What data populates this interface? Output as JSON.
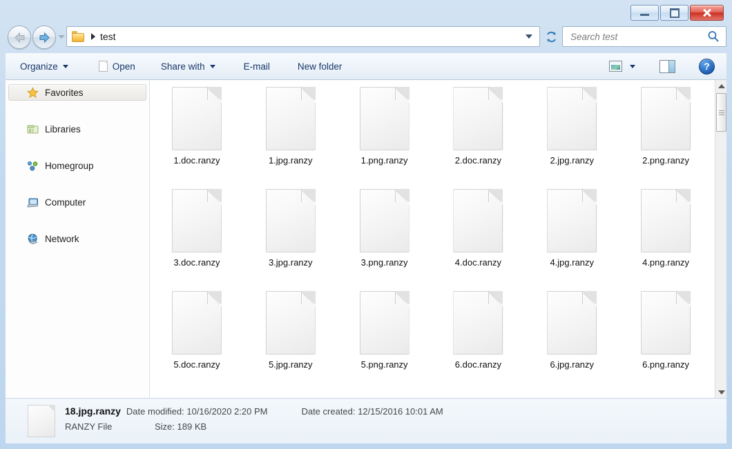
{
  "window": {
    "title": "",
    "controls": {
      "minimize": "Minimize",
      "maximize": "Maximize",
      "close": "Close"
    }
  },
  "navbar": {
    "back": "Back",
    "forward": "Forward",
    "recent_pages": "Recent pages",
    "breadcrumb": {
      "folder_icon": "folder-icon",
      "separator": "▸",
      "path": "test"
    },
    "refresh": "Refresh",
    "search": {
      "placeholder": "Search test",
      "value": "",
      "icon": "search-icon"
    }
  },
  "toolbar": {
    "organize": "Organize",
    "open": "Open",
    "share_with": "Share with",
    "email": "E-mail",
    "new_folder": "New folder",
    "change_view": "change-view-icon",
    "preview_pane": "preview-pane-icon",
    "help": "?"
  },
  "sidebar": {
    "items": [
      {
        "label": "Favorites",
        "icon": "star-icon",
        "selected": true
      },
      {
        "label": "Libraries",
        "icon": "libraries-icon",
        "selected": false
      },
      {
        "label": "Homegroup",
        "icon": "homegroup-icon",
        "selected": false
      },
      {
        "label": "Computer",
        "icon": "computer-icon",
        "selected": false
      },
      {
        "label": "Network",
        "icon": "network-icon",
        "selected": false
      }
    ]
  },
  "content": {
    "view": "large-icons",
    "files": [
      {
        "name": "1.doc.ranzy"
      },
      {
        "name": "1.jpg.ranzy"
      },
      {
        "name": "1.png.ranzy"
      },
      {
        "name": "2.doc.ranzy"
      },
      {
        "name": "2.jpg.ranzy"
      },
      {
        "name": "2.png.ranzy"
      },
      {
        "name": "3.doc.ranzy"
      },
      {
        "name": "3.jpg.ranzy"
      },
      {
        "name": "3.png.ranzy"
      },
      {
        "name": "4.doc.ranzy"
      },
      {
        "name": "4.jpg.ranzy"
      },
      {
        "name": "4.png.ranzy"
      },
      {
        "name": "5.doc.ranzy"
      },
      {
        "name": "5.jpg.ranzy"
      },
      {
        "name": "5.png.ranzy"
      },
      {
        "name": "6.doc.ranzy"
      },
      {
        "name": "6.jpg.ranzy"
      },
      {
        "name": "6.png.ranzy"
      }
    ]
  },
  "statusbar": {
    "file_name": "18.jpg.ranzy",
    "date_modified": "Date modified: 10/16/2020 2:20 PM",
    "date_created": "Date created: 12/15/2016 10:01 AM",
    "file_type": "RANZY File",
    "file_size": "Size: 189 KB"
  },
  "colors": {
    "frame": "#bed6ee",
    "accent": "#19386b",
    "close": "#cd2f22",
    "content_bg": "#ffffff"
  }
}
